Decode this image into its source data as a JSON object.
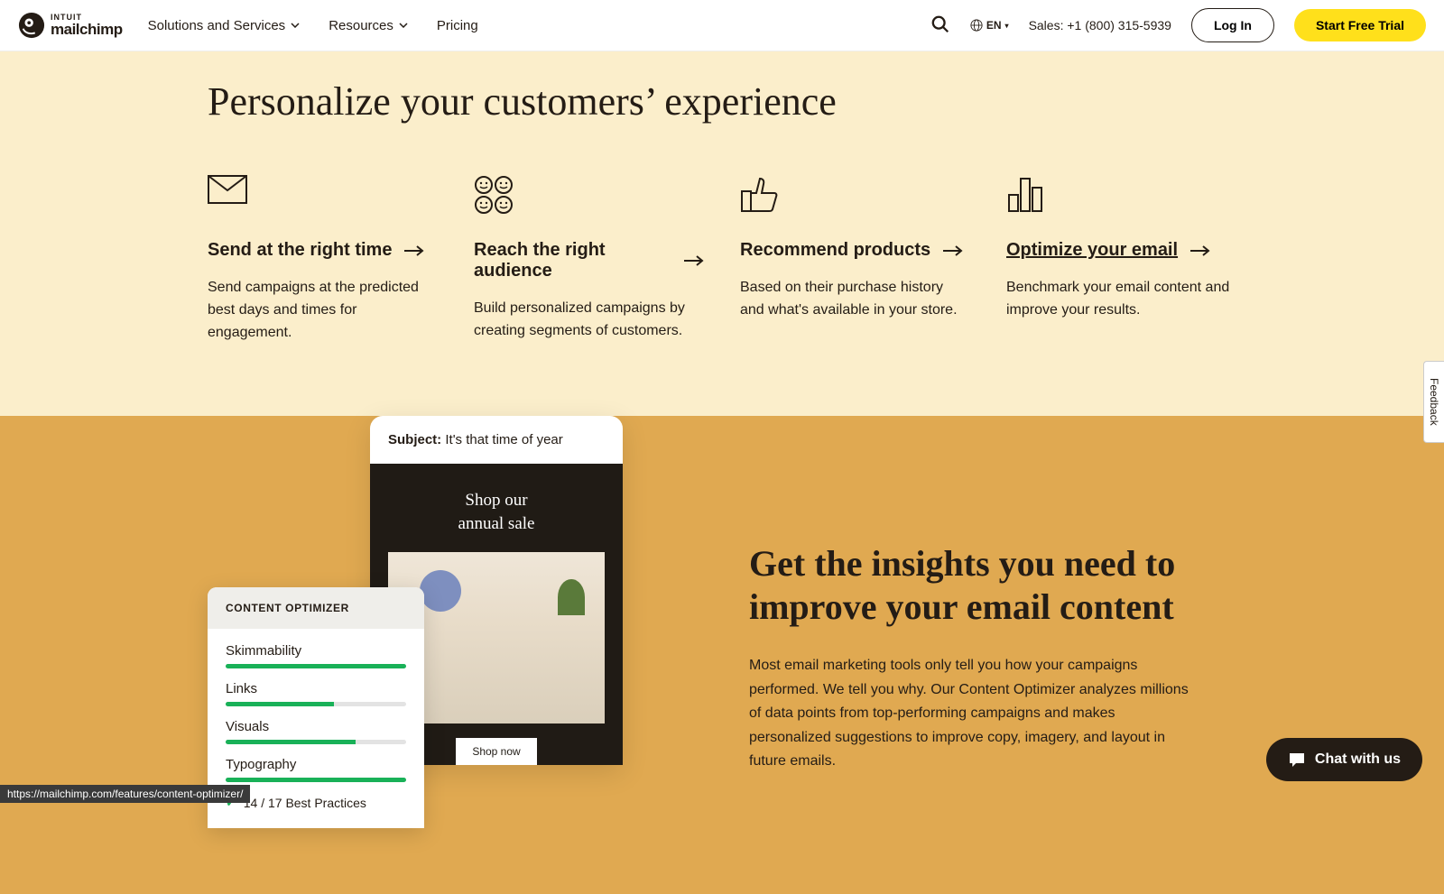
{
  "header": {
    "logo_top": "INTUIT",
    "logo_bottom": "mailchimp",
    "nav": [
      {
        "label": "Solutions and Services",
        "has_chevron": true
      },
      {
        "label": "Resources",
        "has_chevron": true
      },
      {
        "label": "Pricing",
        "has_chevron": false
      }
    ],
    "lang": "EN",
    "sales": "Sales: +1 (800) 315-5939",
    "login": "Log In",
    "trial": "Start Free Trial"
  },
  "personalize": {
    "title": "Personalize your customers’ experience",
    "cards": [
      {
        "icon": "envelope-icon",
        "title": "Send at the right time",
        "desc": "Send campaigns at the predicted best days and times for engagement.",
        "underlined": false
      },
      {
        "icon": "faces-icon",
        "title": "Reach the right audience",
        "desc": "Build personalized campaigns by creating segments of customers.",
        "underlined": false
      },
      {
        "icon": "thumbs-up-icon",
        "title": "Recommend products",
        "desc": "Based on their purchase history and what's available in your store.",
        "underlined": false
      },
      {
        "icon": "bar-chart-icon",
        "title": "Optimize your email",
        "desc": "Benchmark your email content and improve your results.",
        "underlined": true
      }
    ]
  },
  "email_mock": {
    "subject_label": "Subject:",
    "subject_text": " It's that time of year",
    "hero_line1": "Shop our",
    "hero_line2": "annual sale",
    "cta": "Shop now"
  },
  "optimizer": {
    "header": "CONTENT OPTIMIZER",
    "rows": [
      {
        "label": "Skimmability",
        "pct": 100
      },
      {
        "label": "Links",
        "pct": 60
      },
      {
        "label": "Visuals",
        "pct": 72
      },
      {
        "label": "Typography",
        "pct": 100
      }
    ],
    "best_practices": "14 / 17 Best Practices"
  },
  "insights": {
    "title": "Get the insights you need to improve your email content",
    "desc": "Most email marketing tools only tell you how your campaigns performed. We tell you why. Our Content Optimizer analyzes millions of data points from top-performing campaigns and makes personalized suggestions to improve copy, imagery, and layout in future emails."
  },
  "feedback": "Feedback",
  "chat": "Chat with us",
  "status_url": "https://mailchimp.com/features/content-optimizer/"
}
